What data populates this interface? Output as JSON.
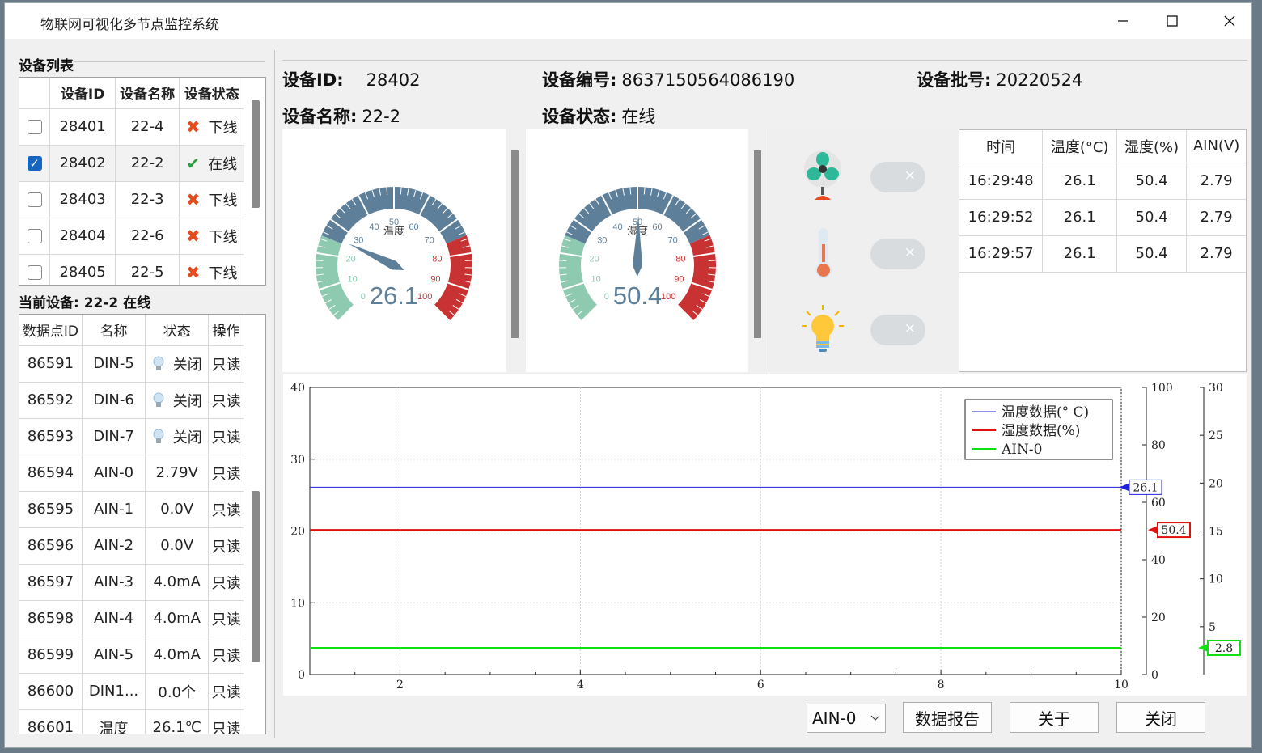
{
  "window": {
    "title": "物联网可视化多节点监控系统"
  },
  "device_list": {
    "title": "设备列表",
    "headers": [
      "",
      "设备ID",
      "设备名称",
      "设备状态"
    ],
    "rows": [
      {
        "checked": false,
        "id": "28401",
        "name": "22-4",
        "status": "下线",
        "online": false
      },
      {
        "checked": true,
        "id": "28402",
        "name": "22-2",
        "status": "在线",
        "online": true
      },
      {
        "checked": false,
        "id": "28403",
        "name": "22-3",
        "status": "下线",
        "online": false
      },
      {
        "checked": false,
        "id": "28404",
        "name": "22-6",
        "status": "下线",
        "online": false
      },
      {
        "checked": false,
        "id": "28405",
        "name": "22-5",
        "status": "下线",
        "online": false
      }
    ]
  },
  "current_device": {
    "title": "当前设备: 22-2 在线",
    "headers": [
      "数据点ID",
      "名称",
      "状态",
      "操作"
    ],
    "rows": [
      {
        "id": "86591",
        "name": "DIN-5",
        "state": "关闭",
        "bulb": true,
        "op": "只读"
      },
      {
        "id": "86592",
        "name": "DIN-6",
        "state": "关闭",
        "bulb": true,
        "op": "只读"
      },
      {
        "id": "86593",
        "name": "DIN-7",
        "state": "关闭",
        "bulb": true,
        "op": "只读"
      },
      {
        "id": "86594",
        "name": "AIN-0",
        "state": "2.79V",
        "bulb": false,
        "op": "只读"
      },
      {
        "id": "86595",
        "name": "AIN-1",
        "state": "0.0V",
        "bulb": false,
        "op": "只读"
      },
      {
        "id": "86596",
        "name": "AIN-2",
        "state": "0.0V",
        "bulb": false,
        "op": "只读"
      },
      {
        "id": "86597",
        "name": "AIN-3",
        "state": "4.0mA",
        "bulb": false,
        "op": "只读"
      },
      {
        "id": "86598",
        "name": "AIN-4",
        "state": "4.0mA",
        "bulb": false,
        "op": "只读"
      },
      {
        "id": "86599",
        "name": "AIN-5",
        "state": "4.0mA",
        "bulb": false,
        "op": "只读"
      },
      {
        "id": "86600",
        "name": "DIN1...",
        "state": "0.0个",
        "bulb": false,
        "op": "只读"
      },
      {
        "id": "86601",
        "name": "温度",
        "state": "26.1℃",
        "bulb": false,
        "op": "只读"
      }
    ]
  },
  "device_info": {
    "id_label": "设备ID:",
    "id_value": "28402",
    "serial_label": "设备编号:",
    "serial_value": "8637150564086190",
    "batch_label": "设备批号:",
    "batch_value": "20220524",
    "name_label": "设备名称:",
    "name_value": "22-2",
    "status_label": "设备状态:",
    "status_value": "在线"
  },
  "gauges": [
    {
      "label": "温度",
      "value": 26.1,
      "display": "26.1",
      "min": 0,
      "max": 100,
      "ticks": [
        "0",
        "10",
        "20",
        "30",
        "40",
        "50",
        "60",
        "70",
        "80",
        "90",
        "100"
      ]
    },
    {
      "label": "湿度",
      "value": 50.4,
      "display": "50.4",
      "min": 0,
      "max": 100,
      "ticks": [
        "0",
        "10",
        "20",
        "30",
        "40",
        "50",
        "60",
        "70",
        "80",
        "90",
        "100"
      ]
    }
  ],
  "controls": [
    {
      "icon": "fan-icon",
      "on": false,
      "mark": "×"
    },
    {
      "icon": "thermometer-icon",
      "on": false,
      "mark": "×"
    },
    {
      "icon": "lightbulb-icon",
      "on": false,
      "mark": "×"
    }
  ],
  "history": {
    "headers": [
      "时间",
      "温度(°C)",
      "湿度(%)",
      "AIN(V)"
    ],
    "rows": [
      [
        "16:29:48",
        "26.1",
        "50.4",
        "2.79"
      ],
      [
        "16:29:52",
        "26.1",
        "50.4",
        "2.79"
      ],
      [
        "16:29:57",
        "26.1",
        "50.4",
        "2.79"
      ]
    ]
  },
  "colors": {
    "temp": "#1f1fe0",
    "hum": "#e01010",
    "ain": "#10e010",
    "gauge_blue": "#5e7f99",
    "gauge_green": "#8ecab0",
    "gauge_red": "#c83232"
  },
  "chart_data": {
    "type": "line",
    "x": [
      1,
      10
    ],
    "xlim": [
      1,
      10
    ],
    "xticks": [
      "2",
      "4",
      "6",
      "8",
      "10"
    ],
    "y_axes": [
      {
        "ylim": [
          0,
          40
        ],
        "ticks": [
          "0",
          "10",
          "20",
          "30",
          "40"
        ]
      },
      {
        "ylim": [
          0,
          100
        ],
        "ticks": [
          "0",
          "20",
          "40",
          "60",
          "80",
          "100"
        ]
      },
      {
        "ylim": [
          0,
          30
        ],
        "ticks": [
          "5",
          "10",
          "15",
          "20",
          "25",
          "30"
        ]
      }
    ],
    "series": [
      {
        "name": "温度数据(° C)",
        "values": [
          26.1,
          26.1
        ],
        "axis": 0,
        "tag": "26.1"
      },
      {
        "name": "湿度数据(%)",
        "values": [
          50.4,
          50.4
        ],
        "axis": 1,
        "tag": "50.4"
      },
      {
        "name": "AIN-0",
        "values": [
          2.79,
          2.79
        ],
        "axis": 2,
        "tag": "2.8"
      }
    ],
    "legend": "top-right",
    "grid": true
  },
  "footer": {
    "select_value": "AIN-0",
    "report_label": "数据报告",
    "about_label": "关于",
    "close_label": "关闭"
  }
}
